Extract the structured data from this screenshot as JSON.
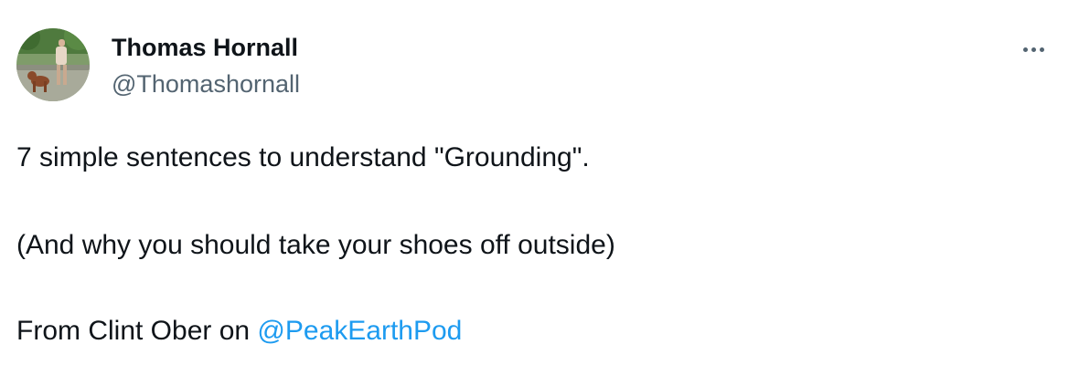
{
  "author": {
    "display_name": "Thomas Hornall",
    "handle": "@Thomashornall",
    "avatar_icon": "profile-photo"
  },
  "menu": {
    "more_icon": "more-horizontal-icon"
  },
  "tweet": {
    "line1": "7 simple sentences to understand \"Grounding\".",
    "line2": "(And why you should take your shoes off outside)",
    "line3_prefix": "From Clint Ober on ",
    "line3_mention": "@PeakEarthPod"
  },
  "colors": {
    "text_primary": "#0f1419",
    "text_secondary": "#536471",
    "link": "#1d9bf0"
  }
}
